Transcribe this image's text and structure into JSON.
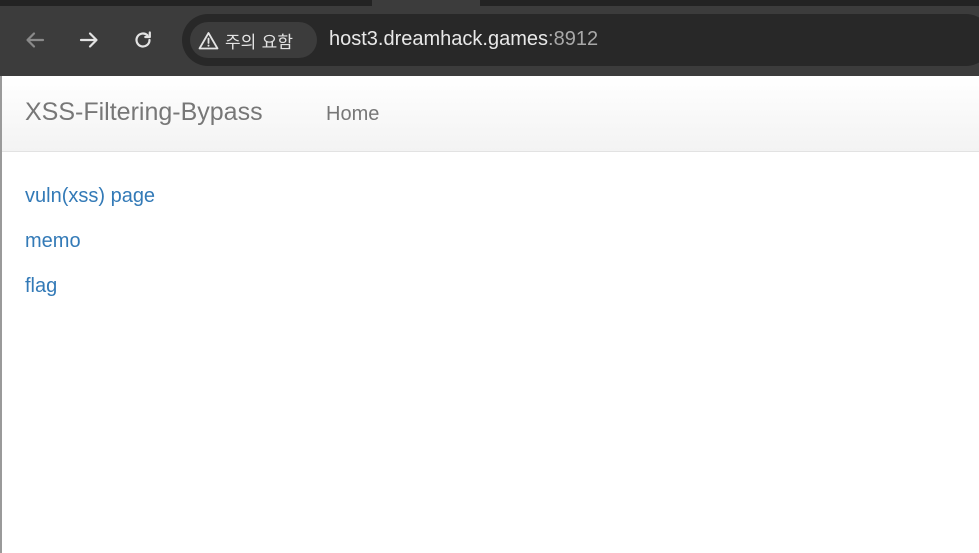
{
  "browser": {
    "security_chip_label": "주의 요함",
    "url_host": "host3.dreamhack.games",
    "url_port": ":8912",
    "icons": {
      "back": "arrow-left-icon",
      "forward": "arrow-right-icon",
      "reload": "reload-icon",
      "warning": "warning-triangle-icon"
    }
  },
  "navbar": {
    "brand": "XSS-Filtering-Bypass",
    "items": [
      {
        "label": "Home"
      }
    ]
  },
  "main": {
    "links": [
      {
        "label": "vuln(xss) page"
      },
      {
        "label": "memo"
      },
      {
        "label": "flag"
      }
    ]
  },
  "colors": {
    "link": "#337ab7",
    "navbar_text": "#777777",
    "chrome_bg": "#3c3c3c",
    "omnibox_bg": "#282828"
  }
}
